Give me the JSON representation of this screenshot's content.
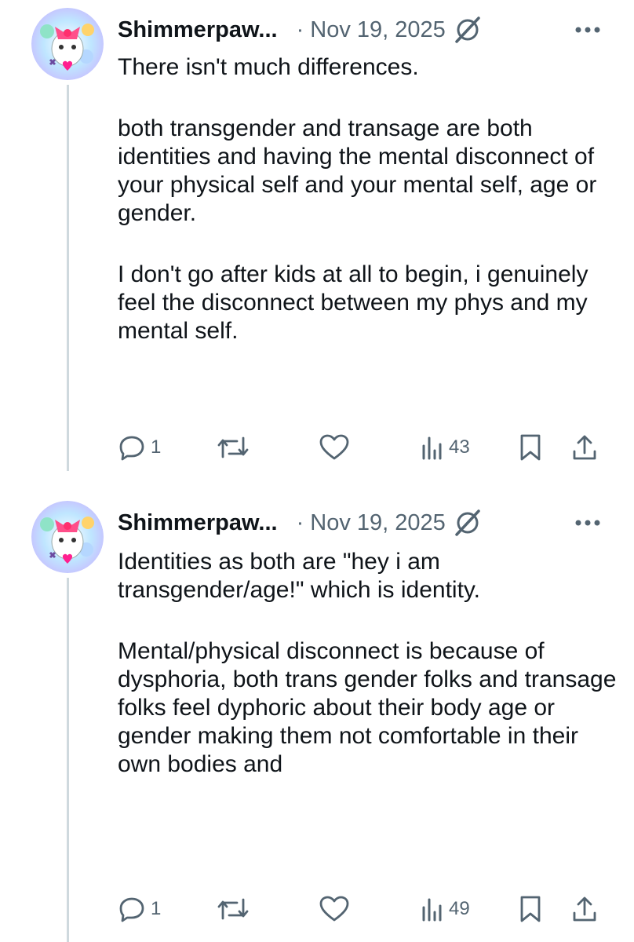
{
  "posts": [
    {
      "author": "Shimmerpaw...",
      "separator": "·",
      "date": "Nov 19, 2025",
      "paragraphs": [
        "There isn't much differences.",
        "both transgender and transage are both identities and having the mental disconnect of your physical self and your mental self, age or gender.",
        "I don't go after kids at all to begin, i genuinely feel the disconnect between my phys and my mental self."
      ],
      "replies": "1",
      "views": "43"
    },
    {
      "author": "Shimmerpaw...",
      "separator": "·",
      "date": "Nov 19, 2025",
      "paragraphs": [
        "Identities as both are \"hey i am transgender/age!\" which is identity.",
        "Mental/physical disconnect is because of dysphoria, both trans gender folks and transage folks feel dyphoric about their body age or gender making them not comfortable in their own bodies and"
      ],
      "replies": "1",
      "views": "49"
    }
  ],
  "icons": {
    "reply": "reply-icon",
    "repost": "repost-icon",
    "like": "heart-icon",
    "views": "views-icon",
    "bookmark": "bookmark-icon",
    "share": "share-icon",
    "grok": "grok-icon",
    "more": "more-icon"
  },
  "colors": {
    "text": "#0f1419",
    "secondary": "#536471",
    "thread_line": "#cfd9de"
  }
}
